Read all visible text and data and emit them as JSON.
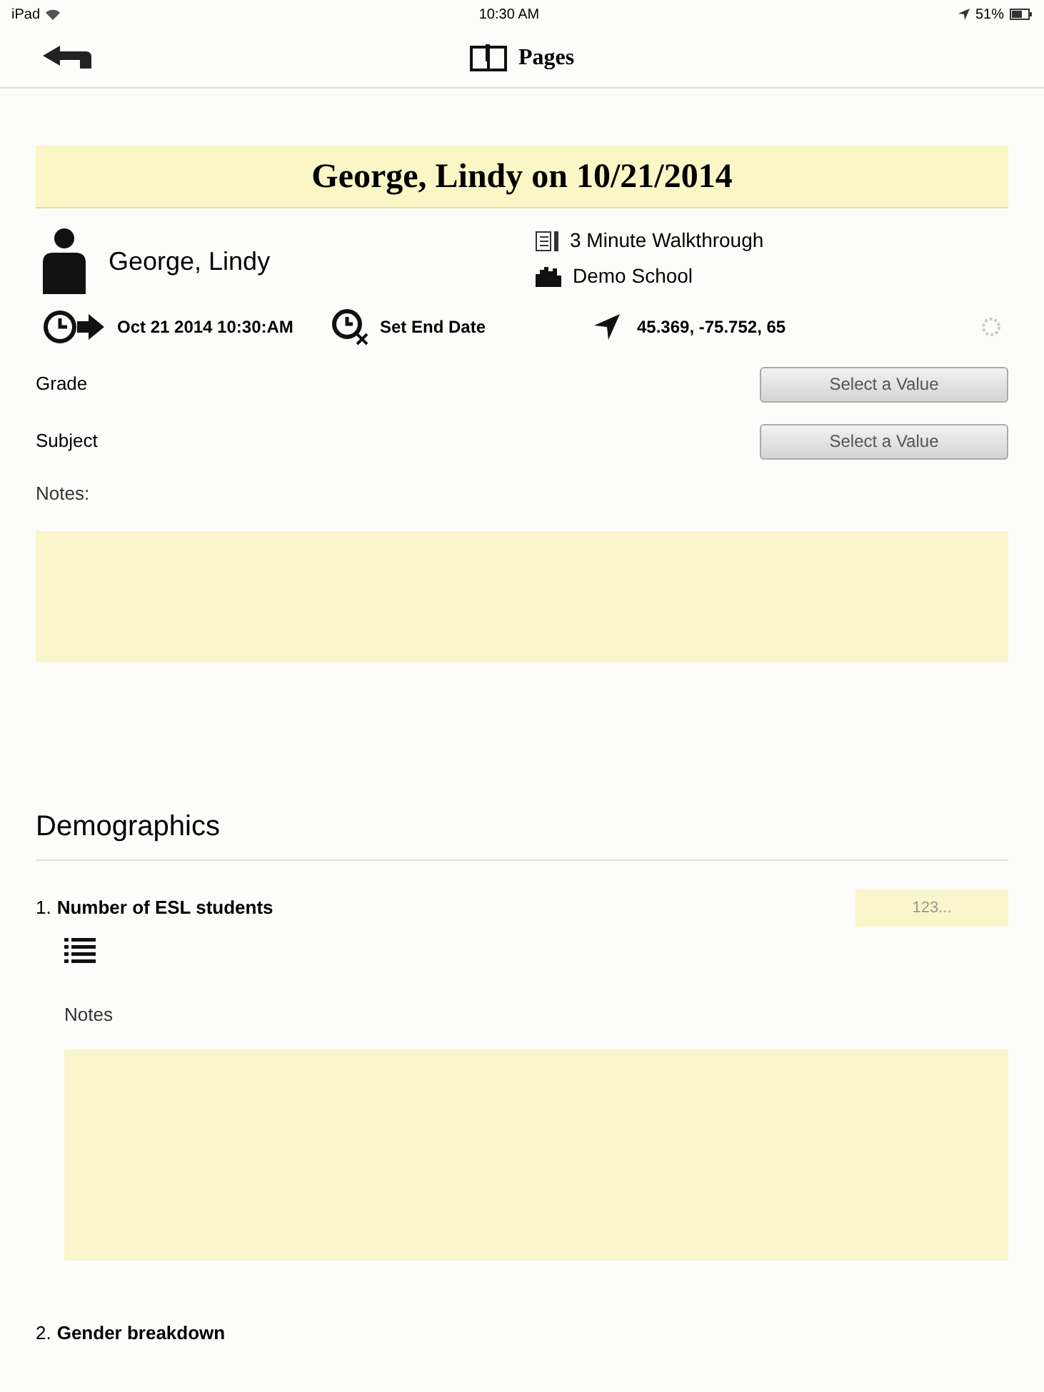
{
  "status_bar": {
    "device": "iPad",
    "time": "10:30 AM",
    "battery": "51%"
  },
  "nav": {
    "title": "Pages"
  },
  "header": {
    "title": "George, Lindy on 10/21/2014"
  },
  "person": {
    "name": "George, Lindy",
    "form": "3 Minute Walkthrough",
    "school": "Demo School"
  },
  "times": {
    "start": "Oct 21 2014 10:30:AM",
    "end": "Set End Date",
    "location": "45.369, -75.752, 65"
  },
  "fields": [
    {
      "label": "Grade",
      "value": "Select a Value"
    },
    {
      "label": "Subject",
      "value": "Select a Value"
    }
  ],
  "notes": {
    "label": "Notes:"
  },
  "section": {
    "title": "Demographics"
  },
  "questions": [
    {
      "number": "1.",
      "label": "Number of ESL students",
      "placeholder": "123...",
      "notes_label": "Notes"
    },
    {
      "number": "2.",
      "label": "Gender breakdown"
    }
  ]
}
